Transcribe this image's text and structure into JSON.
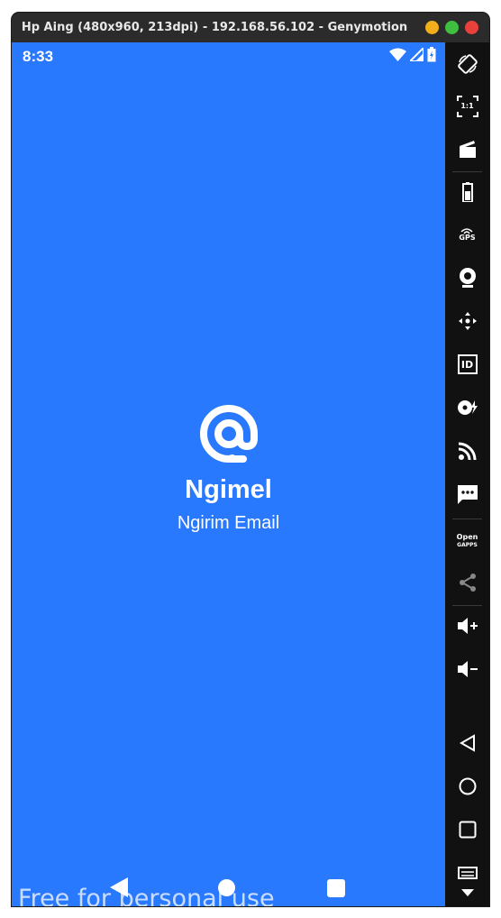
{
  "window": {
    "title": "Hp Aing (480x960, 213dpi) - 192.168.56.102 - Genymotion"
  },
  "status_bar": {
    "time": "8:33"
  },
  "app": {
    "name": "Ngimel",
    "subtitle": "Ngirim Email",
    "logo_icon": "at-sign-icon",
    "background_color": "#2979ff"
  },
  "toolbar": {
    "gps_label": "GPS",
    "id_label": "ID",
    "opengapps_line1": "Open",
    "opengapps_line2": "GAPPS",
    "pixel_label": "1:1"
  },
  "watermark": "Free for personal use"
}
